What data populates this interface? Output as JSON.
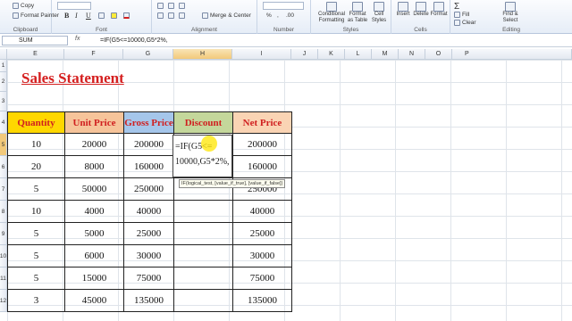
{
  "ribbon": {
    "clipboard": {
      "label": "Clipboard",
      "copy": "Copy",
      "format_painter": "Format Painter"
    },
    "font": {
      "label": "Font",
      "bold": "B",
      "italic": "I",
      "underline": "U"
    },
    "alignment": {
      "label": "Alignment",
      "merge": "Merge & Center"
    },
    "number": {
      "label": "Number",
      "percent": "%",
      "comma": ",",
      "inc_dec": ".00"
    },
    "styles": {
      "label": "Styles",
      "conditional": "Conditional Formatting",
      "format_table": "Format as Table",
      "cell_styles": "Cell Styles"
    },
    "cells": {
      "label": "Cells",
      "insert": "Insert",
      "delete": "Delete",
      "format": "Format"
    },
    "editing": {
      "label": "Editing",
      "fill": "Fill",
      "clear": "Clear",
      "find": "Find & Select"
    }
  },
  "formula_bar": {
    "name_box": "SUM",
    "fx": "fx",
    "formula": "=IF(G5<=10000,G5*2%,"
  },
  "columns": [
    "E",
    "F",
    "G",
    "H",
    "I",
    "J",
    "K",
    "L",
    "M",
    "N",
    "O",
    "P"
  ],
  "active_column": "H",
  "rows": [
    "1",
    "2",
    "3",
    "4",
    "5",
    "6",
    "7",
    "8",
    "9",
    "10",
    "11",
    "12"
  ],
  "active_row": "5",
  "sheet": {
    "title": "Sales Statement",
    "headers": {
      "quantity": "Quantity",
      "unit_price": "Unit Price",
      "gross_price": "Gross Price",
      "discount": "Discount",
      "net_price": "Net Price"
    },
    "data": [
      {
        "qty": "10",
        "unit": "20000",
        "gross": "200000",
        "net": "200000"
      },
      {
        "qty": "20",
        "unit": "8000",
        "gross": "160000",
        "net": "160000"
      },
      {
        "qty": "5",
        "unit": "50000",
        "gross": "250000",
        "net": "250000"
      },
      {
        "qty": "10",
        "unit": "4000",
        "gross": "40000",
        "net": "40000"
      },
      {
        "qty": "5",
        "unit": "5000",
        "gross": "25000",
        "net": "25000"
      },
      {
        "qty": "5",
        "unit": "6000",
        "gross": "30000",
        "net": "30000"
      },
      {
        "qty": "5",
        "unit": "15000",
        "gross": "75000",
        "net": "75000"
      },
      {
        "qty": "3",
        "unit": "45000",
        "gross": "135000",
        "net": "135000"
      }
    ],
    "editing_cell": {
      "line1": "=IF(G5<=",
      "line2": "10000,G5*2%,"
    },
    "tooltip": "IF(logical_test, [value_if_true], [value_if_false])"
  },
  "colors": {
    "title": "#d52020",
    "quantity_header": "#ffd700",
    "unit_price_header": "#f6c49a",
    "gross_price_header": "#a5c6ea",
    "discount_header": "#c4d79b",
    "net_price_header": "#fad4b4"
  }
}
